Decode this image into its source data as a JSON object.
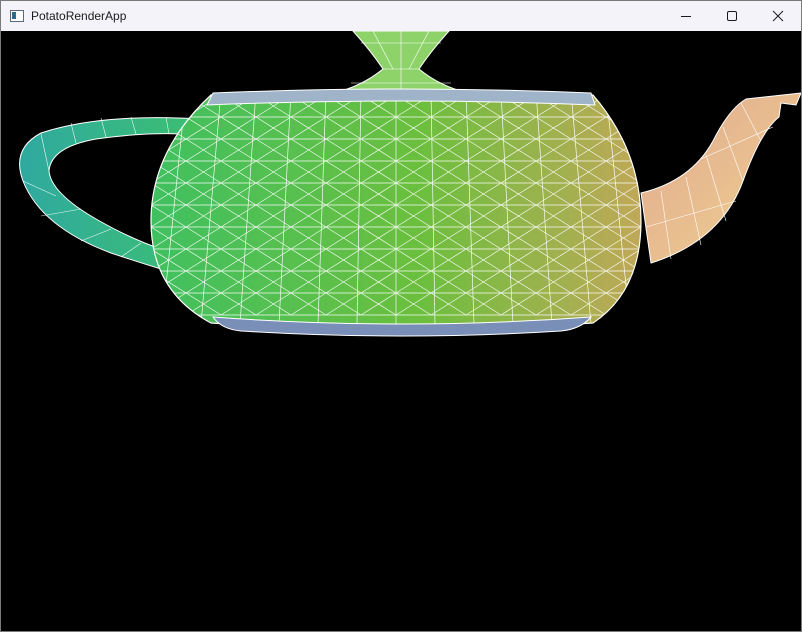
{
  "window": {
    "title": "PotatoRenderApp",
    "icon": "app-window-icon",
    "controls": [
      "minimize-icon",
      "maximize-icon",
      "close-icon"
    ]
  },
  "viewport": {
    "background": "#000000",
    "wireframe_color": "#ffffff",
    "teapot_colors": {
      "handle": "#2fc07f",
      "body_left": "#40c060",
      "body_center": "#6cbf3e",
      "body_right": "#c0a858",
      "spout": "#e8c48a",
      "bottom": "#7a8fb8"
    }
  }
}
